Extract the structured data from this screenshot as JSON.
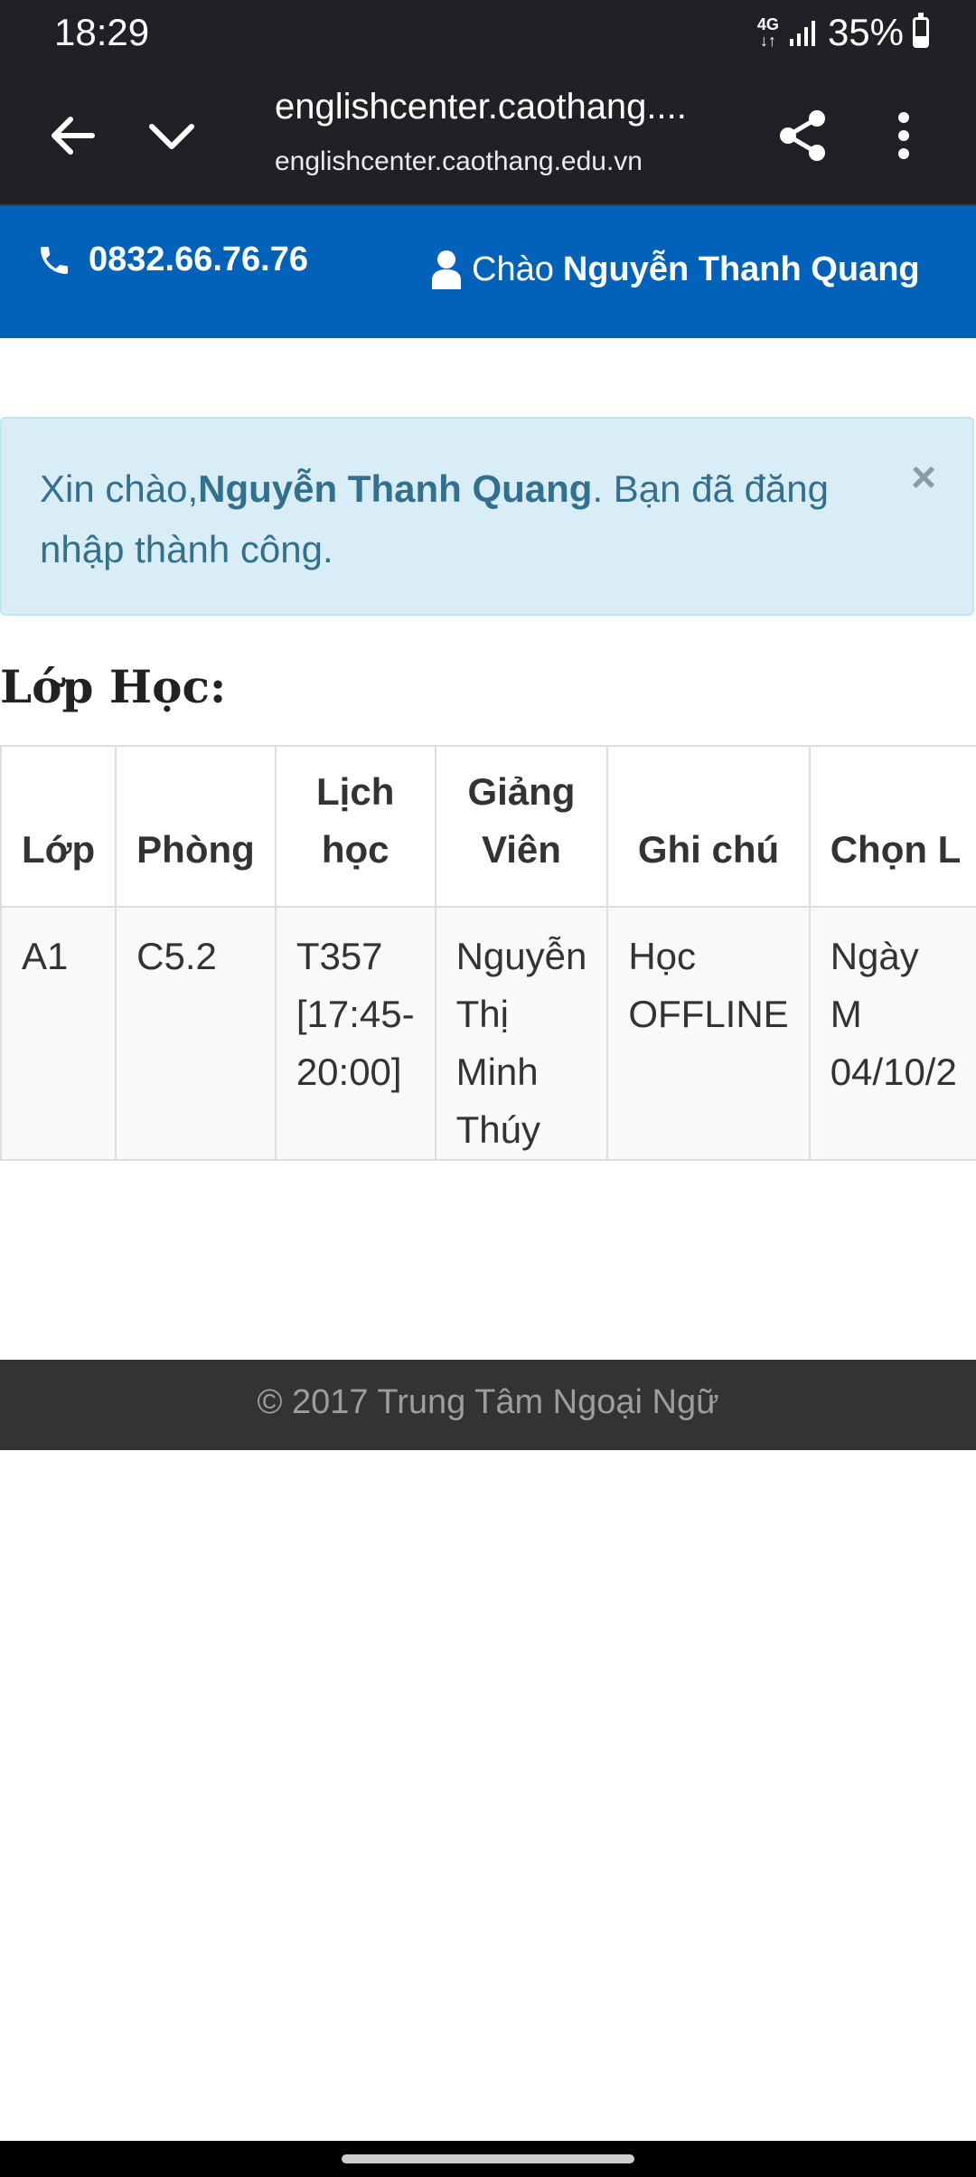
{
  "status_bar": {
    "time": "18:29",
    "network": "4G",
    "battery_percent": "35%",
    "battery_level": 0.35
  },
  "browser": {
    "page_title": "englishcenter.caothang....",
    "domain": "englishcenter.caothang.edu.vn",
    "icons": [
      "back-arrow-icon",
      "chevron-down-icon",
      "share-icon",
      "more-vert-icon"
    ]
  },
  "header": {
    "phone": "0832.66.76.76",
    "greeting": "Chào",
    "user_name": "Nguyễn Thanh Quang",
    "bg_color": "#0262b9"
  },
  "alert": {
    "prefix": "Xin chào,",
    "name": "Nguyễn Thanh Quang",
    "suffix": ". Bạn đã đăng nhập thành công.",
    "close": "×"
  },
  "section": {
    "heading": "Lớp Học:"
  },
  "table": {
    "headers": [
      "Lớp",
      "Phòng",
      "Lịch học",
      "Giảng Viên",
      "Ghi chú",
      "Chọn L"
    ],
    "rows": [
      [
        "A1",
        "C5.2",
        "T357 [17:45-20:00]",
        "Nguyễn Thị Minh Thúy",
        "Học OFFLINE",
        "Ngày M 04/10/2"
      ]
    ]
  },
  "footer": {
    "text": "© 2017 Trung Tâm Ngoại Ngữ"
  }
}
